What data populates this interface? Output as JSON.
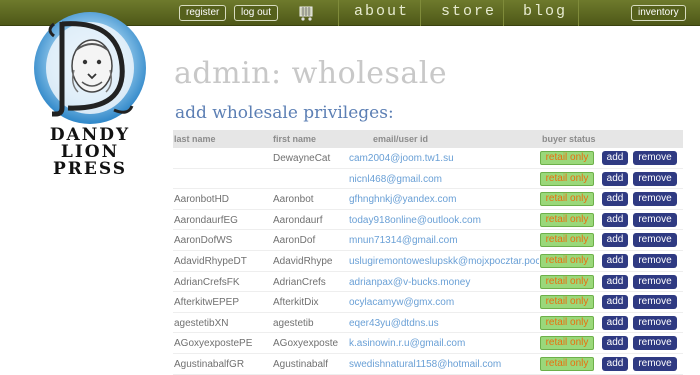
{
  "nav": {
    "register_label": "register",
    "logout_label": "log out",
    "links": [
      "about",
      "store",
      "blog"
    ],
    "inventory_label": "inventory"
  },
  "logo": {
    "lines": [
      "DANDY",
      "LION",
      "PRESS"
    ]
  },
  "page": {
    "title": "admin: wholesale",
    "section_title": "add wholesale privileges:"
  },
  "table": {
    "headers": [
      "last name",
      "first name",
      "email/user id",
      "buyer status"
    ],
    "status_label": "retail only",
    "add_label": "add",
    "remove_label": "remove",
    "rows": [
      {
        "last": "",
        "first": "DewayneCat",
        "email": "cam2004@joom.tw1.su"
      },
      {
        "last": "",
        "first": "",
        "email": "nicnl468@gmail.com"
      },
      {
        "last": "AaronbotHD",
        "first": "Aaronbot",
        "email": "gfhnghnkj@yandex.com"
      },
      {
        "last": "AarondaurfEG",
        "first": "Aarondaurf",
        "email": "today918online@outlook.com"
      },
      {
        "last": "AaronDofWS",
        "first": "AaronDof",
        "email": "mnun71314@gmail.com"
      },
      {
        "last": "AdavidRhypeDT",
        "first": "AdavidRhype",
        "email": "uslugiremontoweslupskk@mojxpocztar.poczt"
      },
      {
        "last": "AdrianCrefsFK",
        "first": "AdrianCrefs",
        "email": "adrianpax@v-bucks.money"
      },
      {
        "last": "AfterkitwEPEP",
        "first": "AfterkitDix",
        "email": "ocylacamyw@gmx.com"
      },
      {
        "last": "agestetibXN",
        "first": "agestetib",
        "email": "eqer43yu@dtdns.us"
      },
      {
        "last": "AGoxyexpostePE",
        "first": "AGoxyexposte",
        "email": "k.asinowin.r.u@gmail.com"
      },
      {
        "last": "AgustinabalfGR",
        "first": "Agustinabalf",
        "email": "swedishnatural1158@hotmail.com"
      }
    ]
  },
  "colors": {
    "nav_bg": "#5a6420",
    "title_gray": "#c8c8c8",
    "section_blue": "#5c7fb4",
    "status_green": "#9ad87a",
    "status_orange": "#e96f10",
    "button_navy": "#2f3a82",
    "email_blue": "#6aa0d6"
  }
}
